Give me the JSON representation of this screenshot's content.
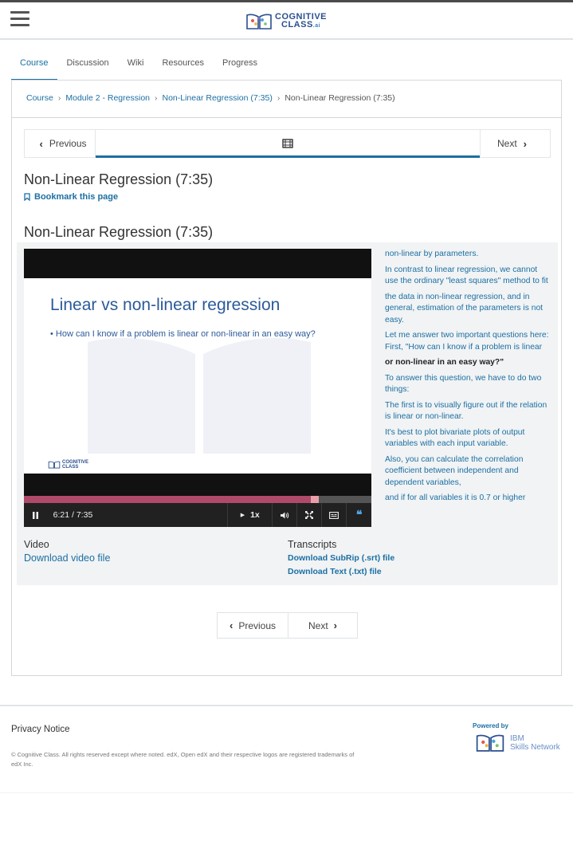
{
  "header": {
    "logo_line1": "COGNITIVE",
    "logo_line2": "CLASS",
    "logo_suffix": ".ai"
  },
  "tabs": [
    {
      "label": "Course",
      "active": true
    },
    {
      "label": "Discussion"
    },
    {
      "label": "Wiki"
    },
    {
      "label": "Resources"
    },
    {
      "label": "Progress"
    }
  ],
  "breadcrumb": {
    "items": [
      "Course",
      "Module 2 - Regression",
      "Non-Linear Regression (7:35)"
    ],
    "current": "Non-Linear Regression (7:35)",
    "separator": "›"
  },
  "sequence_nav": {
    "previous": "Previous",
    "next": "Next",
    "unit_icon": "video-film-icon"
  },
  "unit": {
    "title": "Non-Linear Regression (7:35)",
    "bookmark": "Bookmark this page",
    "video_heading": "Non-Linear Regression (7:35)"
  },
  "video": {
    "slide_title": "Linear vs non-linear regression",
    "slide_bullet": "• How can I know if a problem is linear or non-linear in an easy way?",
    "slide_logo_line1": "COGNITIVE",
    "slide_logo_line2": "CLASS",
    "time": "6:21 / 7:35",
    "speed": "1x",
    "progress_fraction": 0.837,
    "accent_color": "#b04a6a"
  },
  "transcript": [
    {
      "text": "non-linear by parameters."
    },
    {
      "text": "In contrast to linear regression, we cannot use the ordinary \"least squares\" method to fit"
    },
    {
      "text": "the data in non-linear regression, and in general, estimation of the parameters is not easy."
    },
    {
      "text": "Let me answer two important questions here: First, \"How can I know if a problem is linear"
    },
    {
      "text": "or non-linear in an easy way?\"",
      "current": true
    },
    {
      "text": "To answer this question, we have to do two things:"
    },
    {
      "text": "The first is to visually figure out if the relation is linear or non-linear."
    },
    {
      "text": "It's best to plot bivariate plots of output variables with each input variable."
    },
    {
      "text": "Also, you can calculate the correlation coefficient between independent and dependent variables,"
    },
    {
      "text": "and if for all variables it is 0.7 or higher"
    }
  ],
  "downloads": {
    "video_heading": "Video",
    "video_link": "Download video file",
    "transcripts_heading": "Transcripts",
    "srt_link": "Download SubRip (.srt) file",
    "txt_link": "Download Text (.txt) file"
  },
  "bottom_nav": {
    "previous": "Previous",
    "next": "Next"
  },
  "footer": {
    "privacy": "Privacy Notice",
    "copyright": "© Cognitive Class. All rights reserved except where noted. edX, Open edX and their respective logos are registered trademarks of edX Inc.",
    "powered_by": "Powered by",
    "ibm_line1": "IBM",
    "ibm_line2": "Skills Network"
  },
  "colors": {
    "link": "#1c6fa3",
    "brand": "#2a4f8f"
  }
}
